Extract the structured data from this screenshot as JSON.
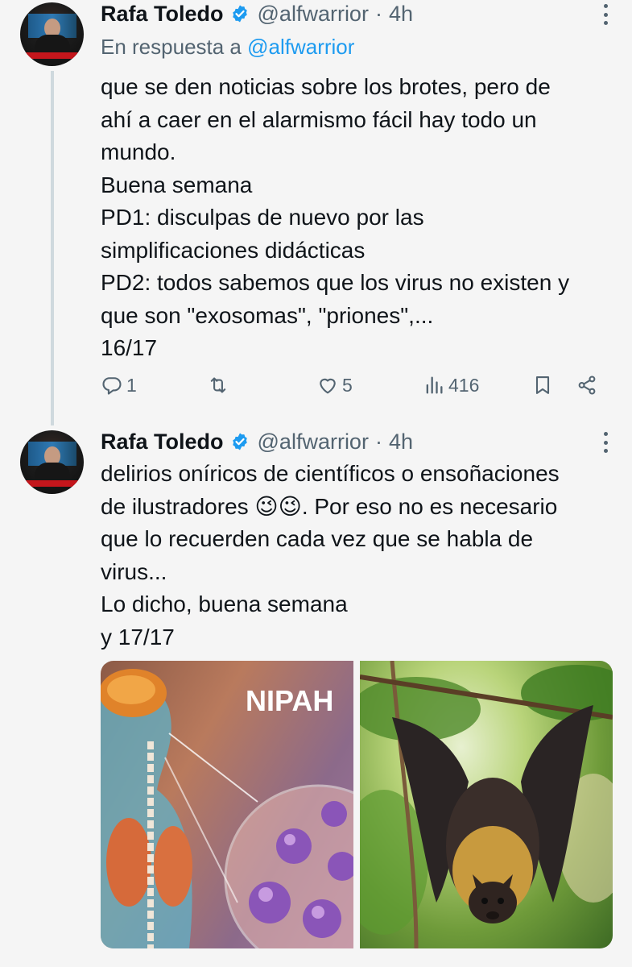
{
  "tweets": [
    {
      "author": {
        "name": "Rafa Toledo",
        "handle": "@alfwarrior",
        "time": "4h",
        "verified": true,
        "avatar_caption": "Dr. Rafael Toledo"
      },
      "replying_prefix": "En respuesta a",
      "replying_to": "@alfwarrior",
      "text": "que se den noticias sobre los brotes, pero de\nahí a caer en el alarmismo fácil hay todo un\nmundo.\nBuena semana\nPD1: disculpas de nuevo por las\nsimplificaciones didácticas\nPD2: todos sabemos que los virus no existen y\nque son \"exosomas\", \"priones\",...\n16/17",
      "actions": {
        "replies": "1",
        "retweets": "",
        "likes": "5",
        "views": "416"
      }
    },
    {
      "author": {
        "name": "Rafa Toledo",
        "handle": "@alfwarrior",
        "time": "4h",
        "verified": true,
        "avatar_caption": "Dr. Rafael Toledo"
      },
      "text": "delirios oníricos de científicos o ensoñaciones\nde ilustradores 😉😉. Por eso no es necesario\nque lo recuerden cada vez que se habla de\nvirus...\nLo dicho, buena semana\ny 17/17",
      "media": [
        {
          "label": "NIPAH",
          "subject": "Illustration of human anatomy with Nipah virus particles"
        },
        {
          "label": "",
          "subject": "Fruit bat hanging upside down from a branch"
        }
      ]
    }
  ],
  "colors": {
    "background": "#f5f5f5",
    "text": "#0f1419",
    "muted": "#536471",
    "accent": "#1d9bf0",
    "thread_line": "#cfd9de"
  },
  "icons": [
    "verified-badge-icon",
    "more-icon",
    "reply-icon",
    "retweet-icon",
    "like-icon",
    "views-icon",
    "bookmark-icon",
    "share-icon"
  ]
}
